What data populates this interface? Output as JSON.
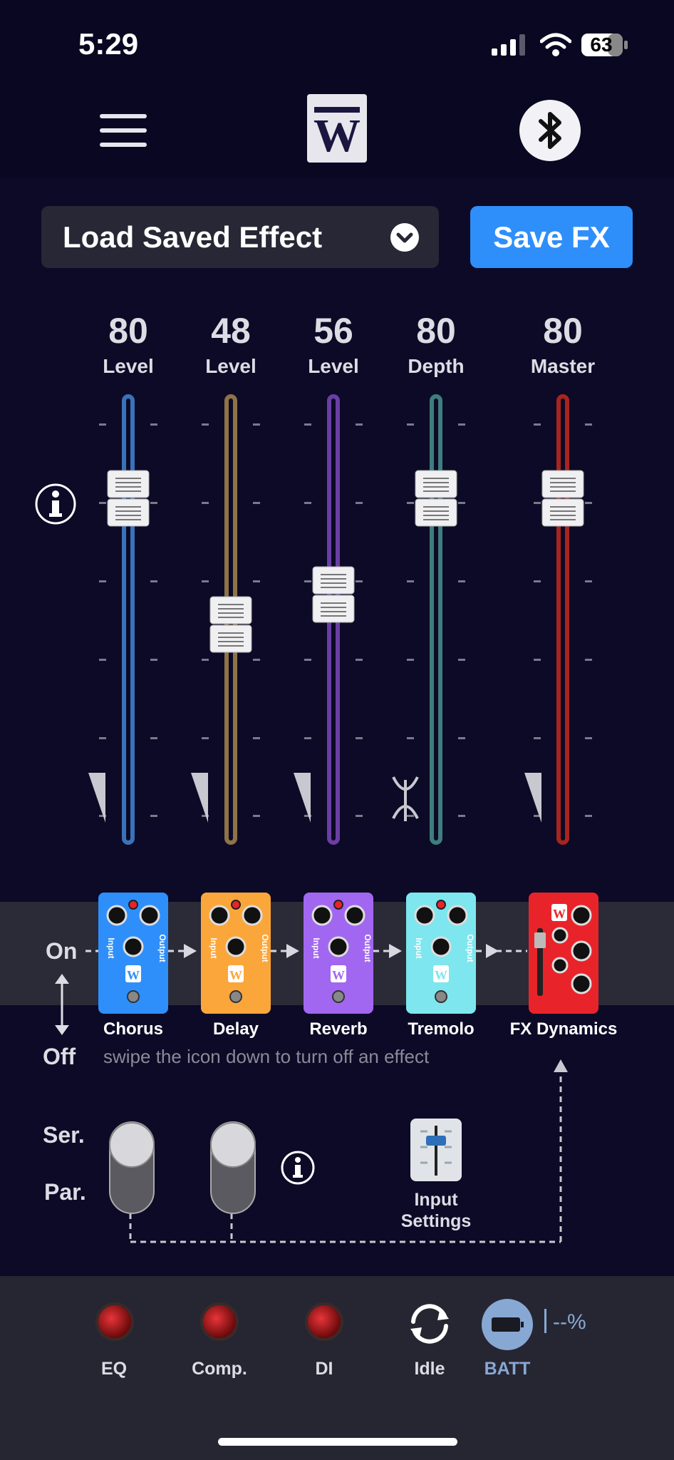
{
  "status": {
    "time": "5:29",
    "battery": "63"
  },
  "header": {
    "logo_letter": "W"
  },
  "controls": {
    "load_label": "Load Saved Effect",
    "save_label": "Save FX"
  },
  "faders": [
    {
      "value": "80",
      "name": "Level",
      "color": "#3a72b8"
    },
    {
      "value": "48",
      "name": "Level",
      "color": "#8e7348"
    },
    {
      "value": "56",
      "name": "Level",
      "color": "#6a3ea4"
    },
    {
      "value": "80",
      "name": "Depth",
      "color": "#3e7e7e"
    },
    {
      "value": "80",
      "name": "Master",
      "color": "#a8241e"
    }
  ],
  "chain": {
    "on_label": "On",
    "off_label": "Off",
    "hint": "swipe the icon down to turn off an effect",
    "pedal_port_in": "Input",
    "pedal_port_out": "Output",
    "pedals": [
      {
        "name": "Chorus",
        "color": "#2e8ffb"
      },
      {
        "name": "Delay",
        "color": "#fba63a"
      },
      {
        "name": "Reverb",
        "color": "#a267f0"
      },
      {
        "name": "Tremolo",
        "color": "#7ee6ee"
      },
      {
        "name": "FX Dynamics",
        "color": "#e8242a"
      }
    ]
  },
  "routing": {
    "ser_label": "Ser.",
    "par_label": "Par.",
    "input_settings_label": "Input\nSettings"
  },
  "bottom": {
    "eq_label": "EQ",
    "comp_label": "Comp.",
    "di_label": "DI",
    "idle_label": "Idle",
    "batt_label": "BATT",
    "batt_pct": "--%"
  }
}
